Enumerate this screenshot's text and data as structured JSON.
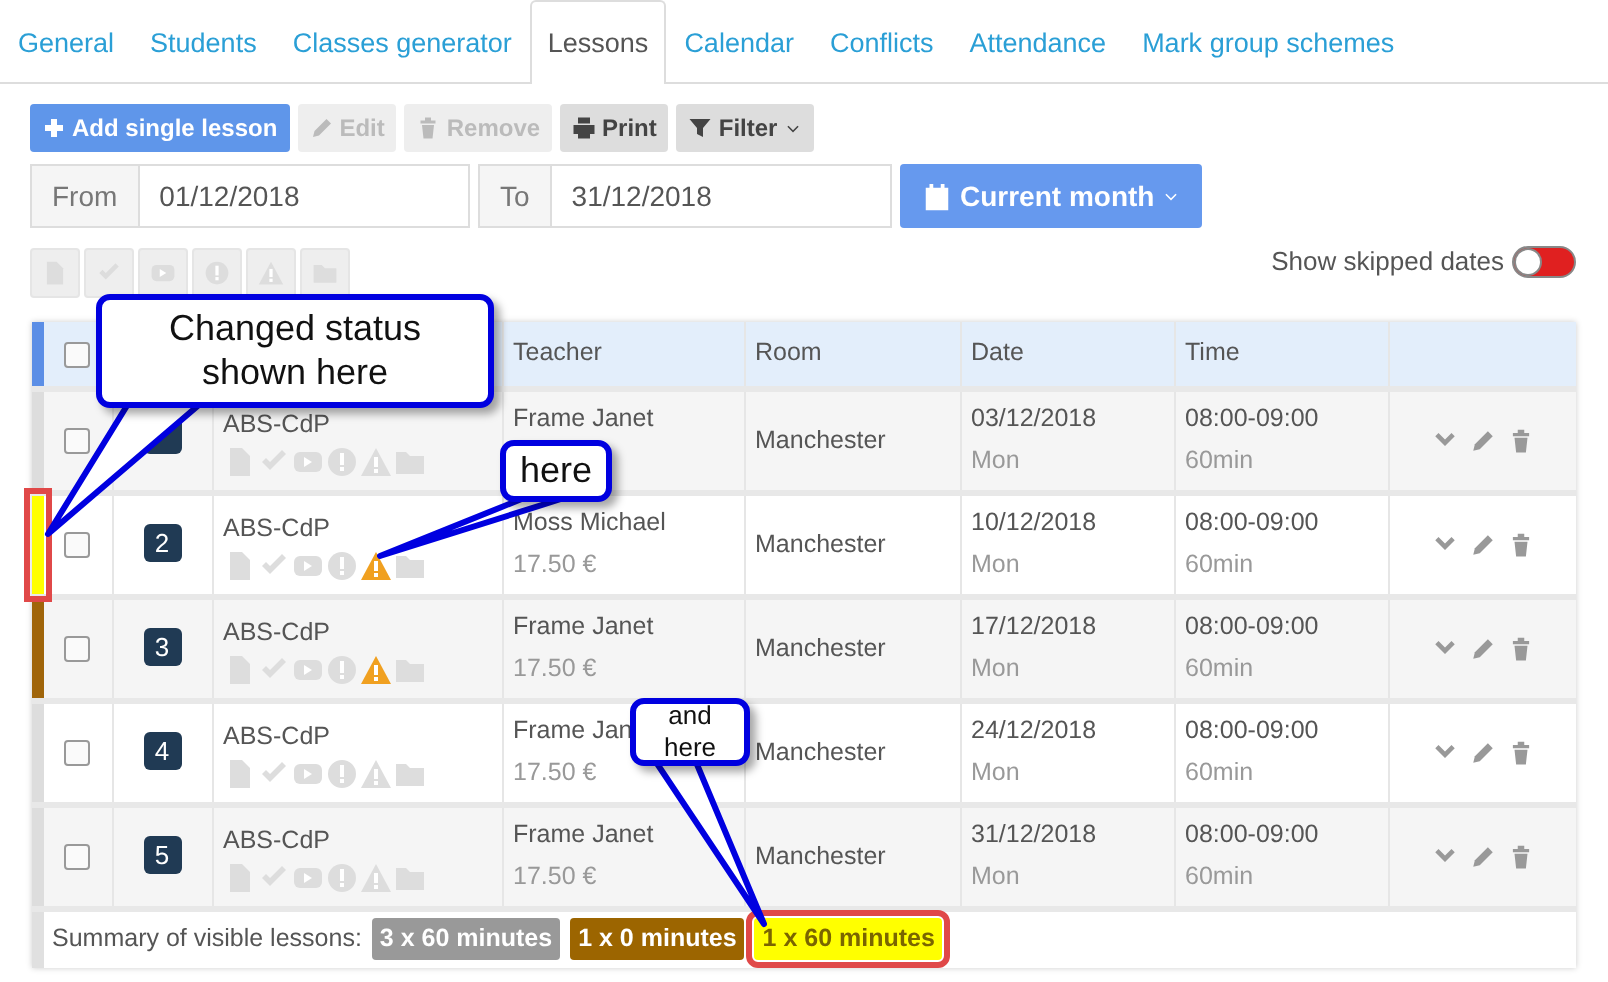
{
  "tabs": [
    {
      "label": "General",
      "selected": false
    },
    {
      "label": "Students",
      "selected": false
    },
    {
      "label": "Classes generator",
      "selected": false
    },
    {
      "label": "Lessons",
      "selected": true
    },
    {
      "label": "Calendar",
      "selected": false
    },
    {
      "label": "Conflicts",
      "selected": false
    },
    {
      "label": "Attendance",
      "selected": false
    },
    {
      "label": "Mark group schemes",
      "selected": false
    }
  ],
  "toolbar": [
    {
      "label": "Add single lesson",
      "kind": "primary",
      "disabled": false,
      "dropdown": false
    },
    {
      "label": "Edit",
      "kind": "default",
      "disabled": true,
      "dropdown": false
    },
    {
      "label": "Remove",
      "kind": "default",
      "disabled": true,
      "dropdown": false
    },
    {
      "label": "Print",
      "kind": "default",
      "disabled": false,
      "dropdown": false
    },
    {
      "label": "Filter",
      "kind": "default",
      "disabled": false,
      "dropdown": true
    }
  ],
  "date_from": {
    "label": "From",
    "value": "01/12/2018"
  },
  "date_to": {
    "label": "To",
    "value": "31/12/2018"
  },
  "period_button": {
    "label": "Current month"
  },
  "status_buttons": [
    {
      "disabled": true
    },
    {
      "disabled": true
    },
    {
      "disabled": true
    },
    {
      "disabled": true
    },
    {
      "disabled": true
    },
    {
      "disabled": true
    }
  ],
  "skipped_toggle": {
    "label": "Show skipped dates",
    "on": false
  },
  "table": {
    "select_all": {
      "checked": false
    },
    "columns": [
      "Teacher",
      "Room",
      "Date",
      "Time"
    ],
    "rows": [
      {
        "color": "#dddddd",
        "highlighted": false,
        "checked": false,
        "lesson": "ABS-CdP",
        "warning": false,
        "teacher": "Frame Janet",
        "room": "Manchester",
        "date": "03/12/2018",
        "day": "Mon",
        "time": "08:00-09:00",
        "duration": "60min"
      },
      {
        "color": "#ffff00",
        "highlighted": true,
        "checked": false,
        "number": "2",
        "lesson": "ABS-CdP",
        "warning": true,
        "teacher": "Moss Michael",
        "price": "17.50 €",
        "room": "Manchester",
        "date": "10/12/2018",
        "day": "Mon",
        "time": "08:00-09:00",
        "duration": "60min"
      },
      {
        "color": "#a0650a",
        "highlighted": false,
        "checked": false,
        "number": "3",
        "lesson": "ABS-CdP",
        "warning": true,
        "teacher": "Frame Janet",
        "price": "17.50 €",
        "room": "Manchester",
        "date": "17/12/2018",
        "day": "Mon",
        "time": "08:00-09:00",
        "duration": "60min"
      },
      {
        "color": "#dddddd",
        "highlighted": false,
        "checked": false,
        "number": "4",
        "lesson": "ABS-CdP",
        "warning": false,
        "teacher": "Frame Jan",
        "price": "17.50 €",
        "room": "Manchester",
        "date": "24/12/2018",
        "day": "Mon",
        "time": "08:00-09:00",
        "duration": "60min"
      },
      {
        "color": "#dddddd",
        "highlighted": false,
        "checked": false,
        "number": "5",
        "lesson": "ABS-CdP",
        "warning": false,
        "teacher": "Frame Janet",
        "price": "17.50 €",
        "room": "Manchester",
        "date": "31/12/2018",
        "day": "Mon",
        "time": "08:00-09:00",
        "duration": "60min"
      }
    ]
  },
  "summary": {
    "label": "Summary of visible lessons:",
    "badges": [
      {
        "text": "3 x 60 minutes",
        "color": "#999999",
        "highlighted": false
      },
      {
        "text": "1 x 0 minutes",
        "color": "#9c6500",
        "highlighted": false
      },
      {
        "text": "1 x 60 minutes",
        "color": "#ffff00",
        "highlighted": true
      }
    ]
  },
  "annotations": [
    {
      "text": "Changed status shown here"
    },
    {
      "text": "here"
    },
    {
      "text": "and here"
    }
  ]
}
